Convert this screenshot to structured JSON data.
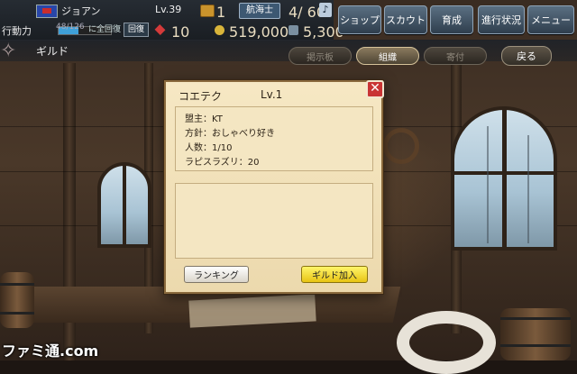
{
  "player": {
    "name": "ジョアン",
    "level": "Lv.39",
    "chest_count": "1",
    "job": "航海士",
    "crew": "4/ 60",
    "note_icon": "music-note-icon",
    "action_label": "行動力",
    "action_value": "48/126",
    "action_fraction": 0.38,
    "action_suffix": "に全回復",
    "heal_label": "回復",
    "gems": "10",
    "gold": "519,000",
    "other_currency": "5,300"
  },
  "menu": {
    "items": [
      "ショップ",
      "スカウト",
      "育成",
      "進行状況",
      "メニュー"
    ]
  },
  "guild_bar": {
    "title": "ギルド",
    "tabs": [
      "掲示板",
      "組織",
      "寄付"
    ],
    "active_tab": "組織",
    "back_label": "戻る"
  },
  "dialog": {
    "guild_name": "コエテク",
    "guild_level": "Lv.1",
    "info": [
      "盟主：KT",
      "方針：おしゃべり好き",
      "人数：1/10",
      "ラピスラズリ：20"
    ],
    "ranking_button": "ランキング",
    "join_button": "ギルド加入",
    "close_label": "✕"
  },
  "watermark": "ファミ通.com",
  "colors": {
    "accent_blue": "#3d5872",
    "close_red": "#c93434",
    "join_yellow": "#e8c414",
    "parchment": "#f4e6c2"
  }
}
